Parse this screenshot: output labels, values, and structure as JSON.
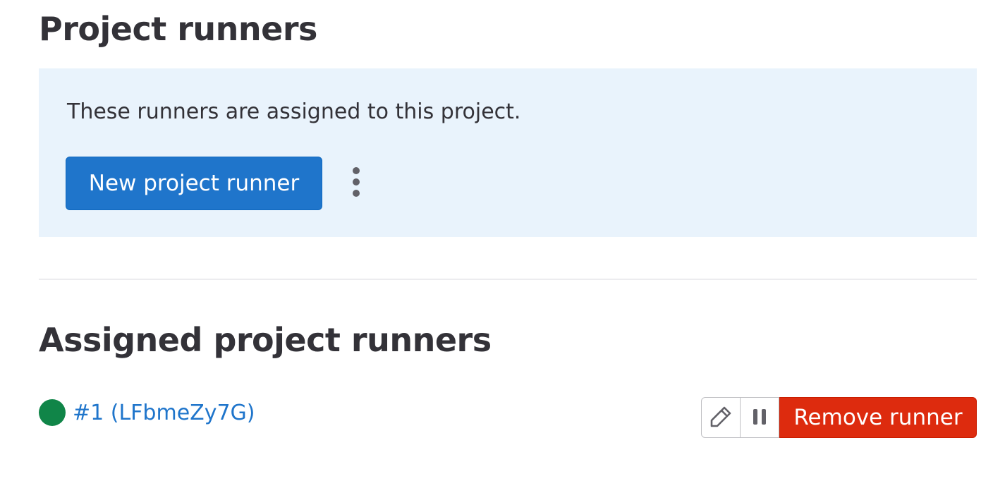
{
  "header": {
    "title": "Project runners"
  },
  "info_panel": {
    "description": "These runners are assigned to this project.",
    "new_runner_label": "New project runner",
    "more_actions_icon": "vertical-ellipsis-icon"
  },
  "assigned": {
    "title": "Assigned project runners",
    "runners": [
      {
        "status": "online",
        "status_color": "#108548",
        "label": "#1 (LFbmeZy7G)",
        "actions": {
          "edit_icon": "pencil-icon",
          "pause_icon": "pause-icon",
          "remove_label": "Remove runner"
        }
      }
    ]
  },
  "colors": {
    "primary": "#1f75cb",
    "danger": "#dd2b0e",
    "panel_background": "#e9f3fc",
    "success": "#108548"
  }
}
